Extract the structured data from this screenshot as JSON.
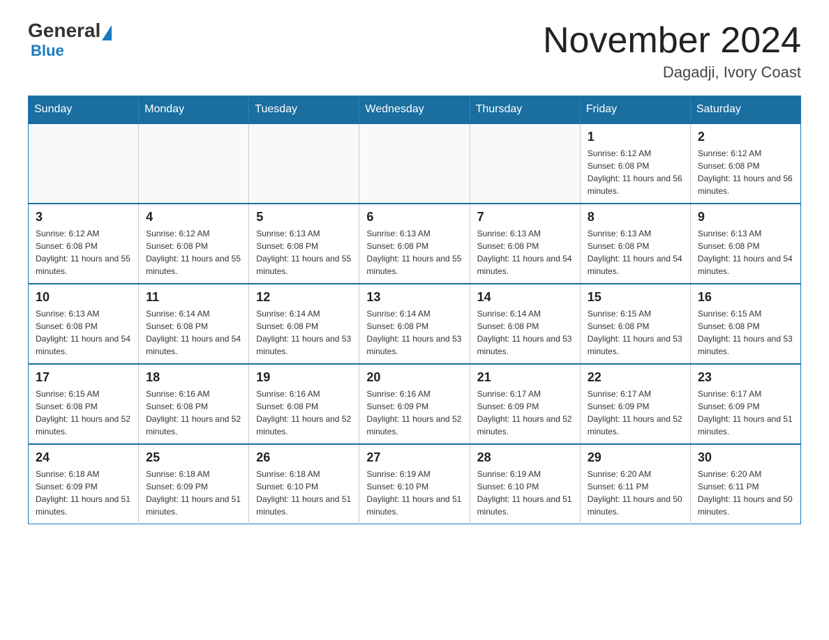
{
  "logo": {
    "general": "General",
    "blue": "Blue"
  },
  "header": {
    "month_year": "November 2024",
    "location": "Dagadji, Ivory Coast"
  },
  "weekdays": [
    "Sunday",
    "Monday",
    "Tuesday",
    "Wednesday",
    "Thursday",
    "Friday",
    "Saturday"
  ],
  "weeks": [
    [
      {
        "day": "",
        "info": ""
      },
      {
        "day": "",
        "info": ""
      },
      {
        "day": "",
        "info": ""
      },
      {
        "day": "",
        "info": ""
      },
      {
        "day": "",
        "info": ""
      },
      {
        "day": "1",
        "info": "Sunrise: 6:12 AM\nSunset: 6:08 PM\nDaylight: 11 hours and 56 minutes."
      },
      {
        "day": "2",
        "info": "Sunrise: 6:12 AM\nSunset: 6:08 PM\nDaylight: 11 hours and 56 minutes."
      }
    ],
    [
      {
        "day": "3",
        "info": "Sunrise: 6:12 AM\nSunset: 6:08 PM\nDaylight: 11 hours and 55 minutes."
      },
      {
        "day": "4",
        "info": "Sunrise: 6:12 AM\nSunset: 6:08 PM\nDaylight: 11 hours and 55 minutes."
      },
      {
        "day": "5",
        "info": "Sunrise: 6:13 AM\nSunset: 6:08 PM\nDaylight: 11 hours and 55 minutes."
      },
      {
        "day": "6",
        "info": "Sunrise: 6:13 AM\nSunset: 6:08 PM\nDaylight: 11 hours and 55 minutes."
      },
      {
        "day": "7",
        "info": "Sunrise: 6:13 AM\nSunset: 6:08 PM\nDaylight: 11 hours and 54 minutes."
      },
      {
        "day": "8",
        "info": "Sunrise: 6:13 AM\nSunset: 6:08 PM\nDaylight: 11 hours and 54 minutes."
      },
      {
        "day": "9",
        "info": "Sunrise: 6:13 AM\nSunset: 6:08 PM\nDaylight: 11 hours and 54 minutes."
      }
    ],
    [
      {
        "day": "10",
        "info": "Sunrise: 6:13 AM\nSunset: 6:08 PM\nDaylight: 11 hours and 54 minutes."
      },
      {
        "day": "11",
        "info": "Sunrise: 6:14 AM\nSunset: 6:08 PM\nDaylight: 11 hours and 54 minutes."
      },
      {
        "day": "12",
        "info": "Sunrise: 6:14 AM\nSunset: 6:08 PM\nDaylight: 11 hours and 53 minutes."
      },
      {
        "day": "13",
        "info": "Sunrise: 6:14 AM\nSunset: 6:08 PM\nDaylight: 11 hours and 53 minutes."
      },
      {
        "day": "14",
        "info": "Sunrise: 6:14 AM\nSunset: 6:08 PM\nDaylight: 11 hours and 53 minutes."
      },
      {
        "day": "15",
        "info": "Sunrise: 6:15 AM\nSunset: 6:08 PM\nDaylight: 11 hours and 53 minutes."
      },
      {
        "day": "16",
        "info": "Sunrise: 6:15 AM\nSunset: 6:08 PM\nDaylight: 11 hours and 53 minutes."
      }
    ],
    [
      {
        "day": "17",
        "info": "Sunrise: 6:15 AM\nSunset: 6:08 PM\nDaylight: 11 hours and 52 minutes."
      },
      {
        "day": "18",
        "info": "Sunrise: 6:16 AM\nSunset: 6:08 PM\nDaylight: 11 hours and 52 minutes."
      },
      {
        "day": "19",
        "info": "Sunrise: 6:16 AM\nSunset: 6:08 PM\nDaylight: 11 hours and 52 minutes."
      },
      {
        "day": "20",
        "info": "Sunrise: 6:16 AM\nSunset: 6:09 PM\nDaylight: 11 hours and 52 minutes."
      },
      {
        "day": "21",
        "info": "Sunrise: 6:17 AM\nSunset: 6:09 PM\nDaylight: 11 hours and 52 minutes."
      },
      {
        "day": "22",
        "info": "Sunrise: 6:17 AM\nSunset: 6:09 PM\nDaylight: 11 hours and 52 minutes."
      },
      {
        "day": "23",
        "info": "Sunrise: 6:17 AM\nSunset: 6:09 PM\nDaylight: 11 hours and 51 minutes."
      }
    ],
    [
      {
        "day": "24",
        "info": "Sunrise: 6:18 AM\nSunset: 6:09 PM\nDaylight: 11 hours and 51 minutes."
      },
      {
        "day": "25",
        "info": "Sunrise: 6:18 AM\nSunset: 6:09 PM\nDaylight: 11 hours and 51 minutes."
      },
      {
        "day": "26",
        "info": "Sunrise: 6:18 AM\nSunset: 6:10 PM\nDaylight: 11 hours and 51 minutes."
      },
      {
        "day": "27",
        "info": "Sunrise: 6:19 AM\nSunset: 6:10 PM\nDaylight: 11 hours and 51 minutes."
      },
      {
        "day": "28",
        "info": "Sunrise: 6:19 AM\nSunset: 6:10 PM\nDaylight: 11 hours and 51 minutes."
      },
      {
        "day": "29",
        "info": "Sunrise: 6:20 AM\nSunset: 6:11 PM\nDaylight: 11 hours and 50 minutes."
      },
      {
        "day": "30",
        "info": "Sunrise: 6:20 AM\nSunset: 6:11 PM\nDaylight: 11 hours and 50 minutes."
      }
    ]
  ]
}
